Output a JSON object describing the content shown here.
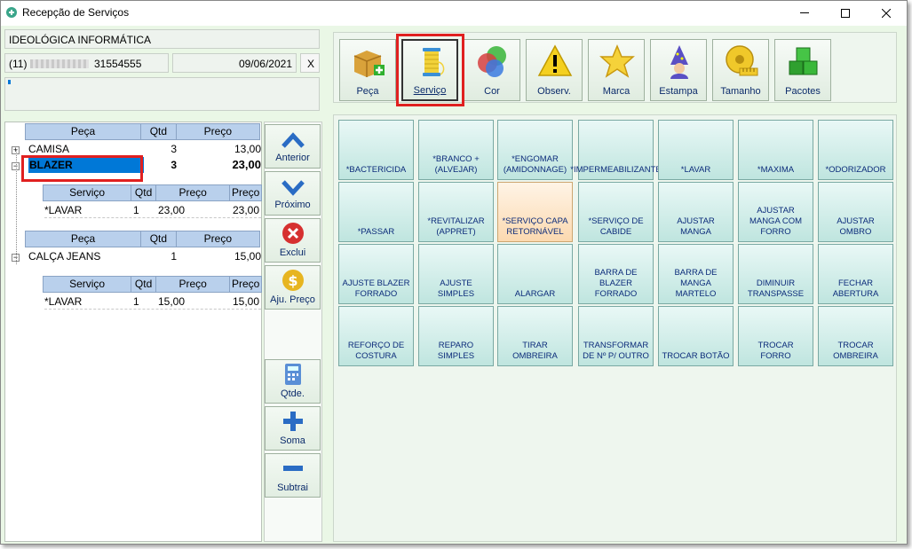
{
  "window": {
    "title": "Recepção de Serviços",
    "icon": "app-icon"
  },
  "client": {
    "name": "IDEOLÓGICA INFORMÁTICA",
    "phone_prefix": "(11)",
    "phone_number": "31554555",
    "date": "09/06/2021",
    "clear_label": "X"
  },
  "grid": {
    "headers": [
      "Peça",
      "Qtd",
      "Preço"
    ],
    "service_headers": [
      "Serviço",
      "Qtd",
      "Preço",
      "Preço"
    ],
    "items": [
      {
        "name": "CAMISA",
        "qty": "3",
        "price": "13,00"
      },
      {
        "name": "BLAZER",
        "qty": "3",
        "price": "23,00",
        "services": [
          {
            "name": "*LAVAR",
            "qty": "1",
            "price": "23,00",
            "total": "23,00"
          }
        ]
      },
      {
        "name": "CALÇA JEANS",
        "qty": "1",
        "price": "15,00",
        "services": [
          {
            "name": "*LAVAR",
            "qty": "1",
            "price": "15,00",
            "total": "15,00"
          }
        ]
      }
    ]
  },
  "nav": {
    "prev": "Anterior",
    "next": "Próximo",
    "delete": "Exclui",
    "adjust_price": "Aju. Preço",
    "qty": "Qtde.",
    "add": "Soma",
    "subtract": "Subtrai"
  },
  "toolbar": {
    "peca": "Peça",
    "servico": "Serviço",
    "cor": "Cor",
    "observ": "Observ.",
    "marca": "Marca",
    "estampa": "Estampa",
    "tamanho": "Tamanho",
    "pacotes": "Pacotes"
  },
  "services": [
    "*BACTERICIDA",
    "*BRANCO + (ALVEJAR)",
    "*ENGOMAR (AMIDONNAGE)",
    "*IMPERMEABILIZANTE",
    "*LAVAR",
    "*MAXIMA",
    "*ODORIZADOR",
    "*PASSAR",
    "*REVITALIZAR (APPRET)",
    "*SERVIÇO CAPA RETORNÁVEL",
    "*SERVIÇO DE CABIDE",
    "AJUSTAR MANGA",
    "AJUSTAR MANGA COM FORRO",
    "AJUSTAR OMBRO",
    "AJUSTE BLAZER FORRADO",
    "AJUSTE SIMPLES",
    "ALARGAR",
    "BARRA DE BLAZER FORRADO",
    "BARRA DE MANGA MARTELO",
    "DIMINUIR TRANSPASSE",
    "FECHAR ABERTURA",
    "REFORÇO DE COSTURA",
    "REPARO SIMPLES",
    "TIRAR OMBREIRA",
    "TRANSFORMAR DE Nº P/ OUTRO",
    "TROCAR BOTÃO",
    "TROCAR FORRO",
    "TROCAR OMBREIRA"
  ],
  "colors": {
    "accent_header": "#b9d0ec",
    "selected": "#0078d7",
    "highlight_red": "#e02020"
  }
}
